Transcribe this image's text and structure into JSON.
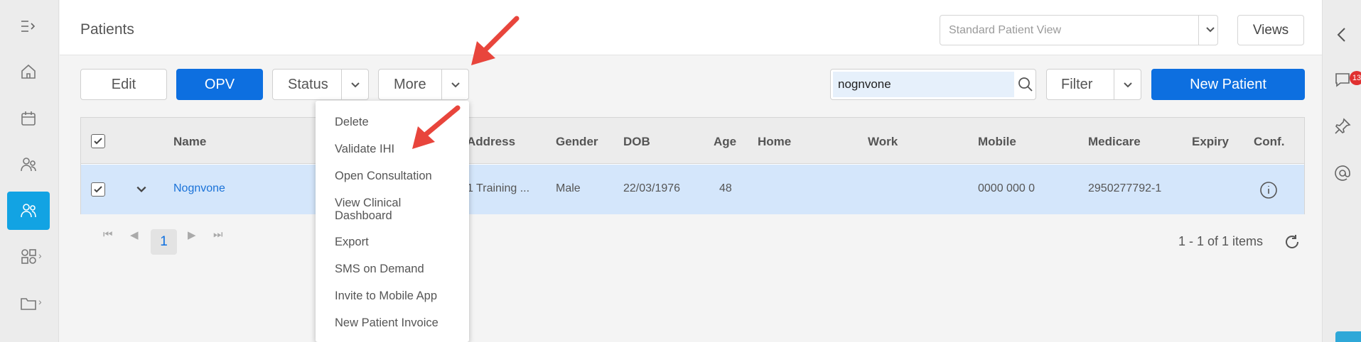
{
  "header": {
    "title": "Patients",
    "view_select": "Standard Patient View",
    "views_label": "Views"
  },
  "toolbar": {
    "edit_label": "Edit",
    "opv_label": "OPV",
    "status_label": "Status",
    "more_label": "More",
    "search_value": "nognvone",
    "filter_label": "Filter",
    "new_patient_label": "New Patient"
  },
  "rail": {
    "chat_badge": "13"
  },
  "table": {
    "columns": [
      "Name",
      "Address",
      "Gender",
      "DOB",
      "Age",
      "Home",
      "Work",
      "Mobile",
      "Medicare",
      "Expiry",
      "Conf."
    ],
    "row": {
      "name": "Nognvone",
      "address": "1 Training ...",
      "gender": "Male",
      "dob": "22/03/1976",
      "age": "48",
      "home": "",
      "work": "",
      "mobile": "0000 000 0",
      "medicare": "2950277792-1",
      "expiry": ""
    }
  },
  "pager": {
    "current_page": "1",
    "items": "1 - 1 of 1 items"
  },
  "more_menu": {
    "items": [
      "Delete",
      "Validate IHI",
      "Open Consultation",
      "View Clinical\nDashboard",
      "Export",
      "SMS on Demand",
      "Invite to Mobile App",
      "New Patient Invoice"
    ]
  },
  "colors": {
    "primary": "#0d6fe0",
    "nav_active": "#12a3e3",
    "row_selected": "#d4e6fb",
    "arrow": "#e8453c"
  }
}
